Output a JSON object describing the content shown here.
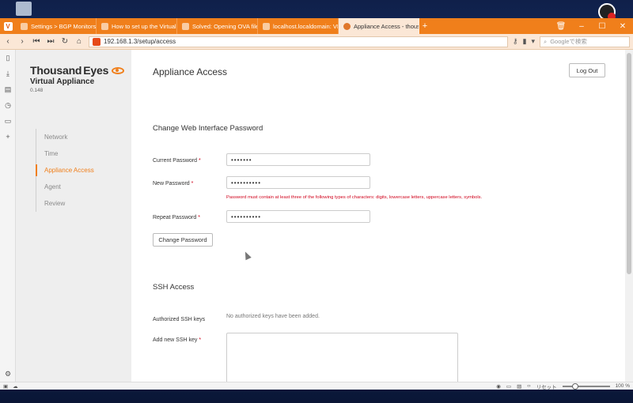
{
  "tabs": [
    {
      "label": "Settings > BGP Monitors - T",
      "active": false
    },
    {
      "label": "How to set up the Virtual A",
      "active": false
    },
    {
      "label": "Solved: Opening OVA file in",
      "active": false
    },
    {
      "label": "localhost.localdomain: VMw",
      "active": false
    },
    {
      "label": "Appliance Access - thousan",
      "active": true
    }
  ],
  "addressbar": {
    "url": "192.168.1.3/setup/access",
    "search_placeholder": "Googleで検索"
  },
  "brand": {
    "name_part1": "Thousand",
    "name_part2": "Eyes",
    "subtitle": "Virtual Appliance",
    "version": "0.148",
    "accent_color": "#f07f1b"
  },
  "steps": [
    {
      "label": "Network",
      "active": false
    },
    {
      "label": "Time",
      "active": false
    },
    {
      "label": "Appliance Access",
      "active": true
    },
    {
      "label": "Agent",
      "active": false
    },
    {
      "label": "Review",
      "active": false
    }
  ],
  "header": {
    "title": "Appliance Access",
    "logout_label": "Log Out"
  },
  "password_section": {
    "title": "Change Web Interface Password",
    "current_label": "Current Password",
    "current_value": "•••••••",
    "new_label": "New Password",
    "new_value": "••••••••••",
    "help_text": "Password must contain at least three of the following types of characters: digits, lowercase letters, uppercase letters, symbols.",
    "repeat_label": "Repeat Password",
    "repeat_value": "••••••••••",
    "required_marker": "*",
    "button_label": "Change Password"
  },
  "ssh_section": {
    "title": "SSH Access",
    "authorized_label": "Authorized SSH keys",
    "authorized_value": "No authorized keys have been added.",
    "add_label": "Add new SSH key",
    "required_marker": "*"
  },
  "statusbar": {
    "reset_label": "リセット",
    "zoom": "100 %"
  }
}
